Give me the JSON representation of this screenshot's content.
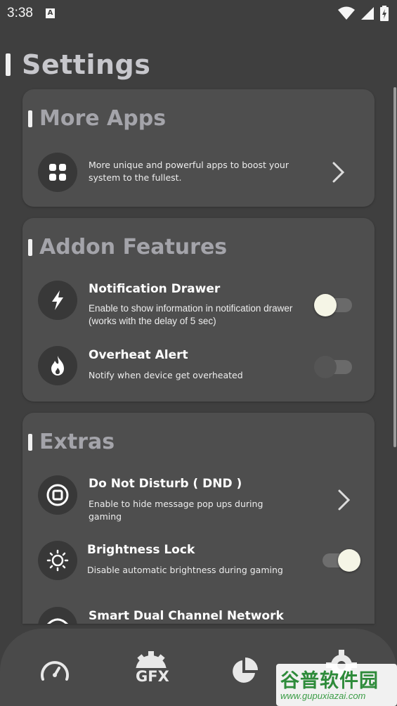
{
  "status_bar": {
    "time": "3:38",
    "notification_badge": "A",
    "icons": [
      "wifi-icon",
      "signal-icon",
      "battery-charging-icon"
    ]
  },
  "page": {
    "title": "Settings"
  },
  "more_apps": {
    "title": "More Apps",
    "item": {
      "icon": "grid-apps-icon",
      "description": "More unique and powerful apps to boost your system to the fullest."
    }
  },
  "addon_features": {
    "title": "Addon Features",
    "items": [
      {
        "icon": "lightning-icon",
        "title": "Notification Drawer",
        "description": "Enable to show information in notification drawer (works with the delay of 5 sec)",
        "toggle_on": false
      },
      {
        "icon": "flame-icon",
        "title": "Overheat Alert",
        "description": "Notify when device get overheated",
        "toggle_on": false
      }
    ]
  },
  "extras": {
    "title": "Extras",
    "items": [
      {
        "icon": "dnd-icon",
        "title": "Do Not Disturb ( DND )",
        "description": "Enable to hide message pop ups during gaming"
      },
      {
        "icon": "brightness-icon",
        "title": "Brightness Lock",
        "description": "Disable automatic brightness during gaming",
        "toggle_on": true
      },
      {
        "icon": "wifi-icon",
        "title": "Smart Dual Channel Network"
      }
    ]
  },
  "bottom_nav": {
    "items": [
      {
        "icon": "speedometer-icon"
      },
      {
        "icon": "gfx-gear-icon",
        "label": "GFX"
      },
      {
        "icon": "pie-chart-icon"
      },
      {
        "icon": "settings-gear-icon"
      }
    ]
  },
  "watermark": {
    "main": "谷普软件园",
    "url": "www.gupuxiazai.com"
  },
  "colors": {
    "background": "#3f3f3f",
    "card": "#4e4e4e",
    "icon_circle": "#383838",
    "card_title": "#a4a4aa",
    "toggle_knob": "#f5f5e6"
  }
}
